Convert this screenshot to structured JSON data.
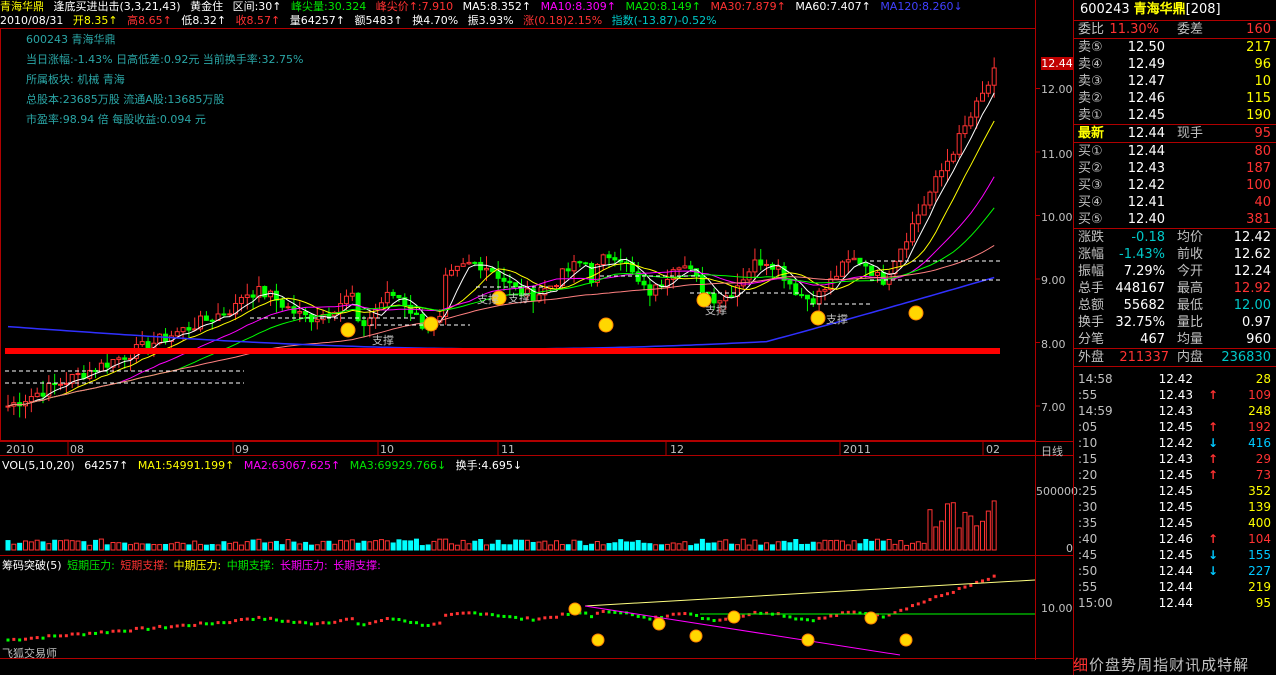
{
  "topbar": {
    "stock_name": "青海华鼎",
    "formula": "逢底买进出击(3,3,21,43)",
    "gold_line": "黄金住",
    "interval": "区间:30↑",
    "peak_vol": "峰尖量:30.324",
    "peak_price": "峰尖价↑:7.910",
    "ma5": "MA5:8.352↑",
    "ma10": "MA10:8.309↑",
    "ma20": "MA20:8.149↑",
    "ma30": "MA30:7.879↑",
    "ma60": "MA60:7.407↑",
    "ma120": "MA120:8.260↓",
    "date": "2010/08/31",
    "open": "开8.35↑",
    "high": "高8.65↑",
    "low": "低8.32↑",
    "close": "收8.57↑",
    "volume": "量64257↑",
    "amount": "额5483↑",
    "turnover": "换4.70%",
    "amplitude": "振3.93%",
    "change": "涨(0.18)2.15%",
    "index": "指数(-13.87)-0.52%"
  },
  "info": {
    "code_name": "600243 青海华鼎",
    "line1": "当日涨幅:-1.43%  日高低差:0.92元  当前换手率:32.75%",
    "line2": "所属板块: 机械 青海",
    "line3": "总股本:23685万股 流通A股:13685万股",
    "line4": "市盈率:98.94 倍  每股收益:0.094 元"
  },
  "price_axis": [
    "12.00",
    "11.00",
    "10.00",
    "9.00",
    "8.00",
    "7.00"
  ],
  "current_price_tag": "12.44",
  "date_axis": [
    "2010",
    "08",
    "09",
    "10",
    "11",
    "12",
    "2011",
    "02"
  ],
  "period_label": "日线",
  "annotations": {
    "support": "支撑"
  },
  "volume": {
    "label": "VOL(5,10,20)",
    "value": "64257↑",
    "ma1": "MA1:54991.199↑",
    "ma2": "MA2:63067.625↑",
    "ma3": "MA3:69929.766↓",
    "turnover": "换手:4.695↓",
    "axis_top": "500000",
    "axis_bottom": "0"
  },
  "indicator": {
    "label": "筹码突破(5)",
    "items": [
      "短期压力:",
      "短期支撑:",
      "中期压力:",
      "中期支撑:",
      "长期压力:",
      "长期支撑:"
    ],
    "axis": "10.00"
  },
  "watermark": "飞狐交易师",
  "right_panel": {
    "code": "600243",
    "name": "青海华鼎",
    "num": "[208]",
    "weibi_label": "委比",
    "weibi": "11.30%",
    "weicha_label": "委差",
    "weicha": "160",
    "sells": [
      {
        "label": "卖⑤",
        "price": "12.50",
        "vol": "217"
      },
      {
        "label": "卖④",
        "price": "12.49",
        "vol": "96"
      },
      {
        "label": "卖③",
        "price": "12.47",
        "vol": "10"
      },
      {
        "label": "卖②",
        "price": "12.46",
        "vol": "115"
      },
      {
        "label": "卖①",
        "price": "12.45",
        "vol": "190"
      }
    ],
    "latest_label": "最新",
    "latest": "12.44",
    "xianshou_label": "现手",
    "xianshou": "95",
    "buys": [
      {
        "label": "买①",
        "price": "12.44",
        "vol": "80"
      },
      {
        "label": "买②",
        "price": "12.43",
        "vol": "187"
      },
      {
        "label": "买③",
        "price": "12.42",
        "vol": "100"
      },
      {
        "label": "买④",
        "price": "12.41",
        "vol": "40"
      },
      {
        "label": "买⑤",
        "price": "12.40",
        "vol": "381"
      }
    ],
    "stats": [
      {
        "l1": "涨跌",
        "v1": "-0.18",
        "l2": "均价",
        "v2": "12.42"
      },
      {
        "l1": "涨幅",
        "v1": "-1.43%",
        "l2": "前收",
        "v2": "12.62"
      },
      {
        "l1": "振幅",
        "v1": "7.29%",
        "l2": "今开",
        "v2": "12.24"
      },
      {
        "l1": "总手",
        "v1": "448167",
        "l2": "最高",
        "v2": "12.92"
      },
      {
        "l1": "总额",
        "v1": "55682",
        "l2": "最低",
        "v2": "12.00"
      },
      {
        "l1": "换手",
        "v1": "32.75%",
        "l2": "量比",
        "v2": "0.97"
      },
      {
        "l1": "分笔",
        "v1": "467",
        "l2": "均量",
        "v2": "960"
      }
    ],
    "outer_label": "外盘",
    "outer": "211337",
    "inner_label": "内盘",
    "inner": "236830",
    "ticks": [
      {
        "t": "14:58",
        "p": "12.42",
        "a": "",
        "v": "28"
      },
      {
        "t": ":55",
        "p": "12.43",
        "a": "↑",
        "v": "109"
      },
      {
        "t": "14:59",
        "p": "12.43",
        "a": "",
        "v": "248"
      },
      {
        "t": ":05",
        "p": "12.45",
        "a": "↑",
        "v": "192"
      },
      {
        "t": ":10",
        "p": "12.42",
        "a": "↓",
        "v": "416"
      },
      {
        "t": ":15",
        "p": "12.43",
        "a": "↑",
        "v": "29"
      },
      {
        "t": ":20",
        "p": "12.45",
        "a": "↑",
        "v": "73"
      },
      {
        "t": ":25",
        "p": "12.45",
        "a": "",
        "v": "352"
      },
      {
        "t": ":30",
        "p": "12.45",
        "a": "",
        "v": "139"
      },
      {
        "t": ":35",
        "p": "12.45",
        "a": "",
        "v": "400"
      },
      {
        "t": ":40",
        "p": "12.46",
        "a": "↑",
        "v": "104"
      },
      {
        "t": ":45",
        "p": "12.45",
        "a": "↓",
        "v": "155"
      },
      {
        "t": ":50",
        "p": "12.44",
        "a": "↓",
        "v": "227"
      },
      {
        "t": ":55",
        "p": "12.44",
        "a": "",
        "v": "219"
      },
      {
        "t": "15:00",
        "p": "12.44",
        "a": "",
        "v": "95"
      }
    ],
    "tabs": [
      "细",
      "价",
      "盘",
      "势",
      "周",
      "指",
      "财",
      "讯",
      "成",
      "特",
      "解"
    ]
  },
  "colors": {
    "up": "#ff3232",
    "down": "#00e6e6",
    "bg": "#000000",
    "grid": "#b00000"
  }
}
